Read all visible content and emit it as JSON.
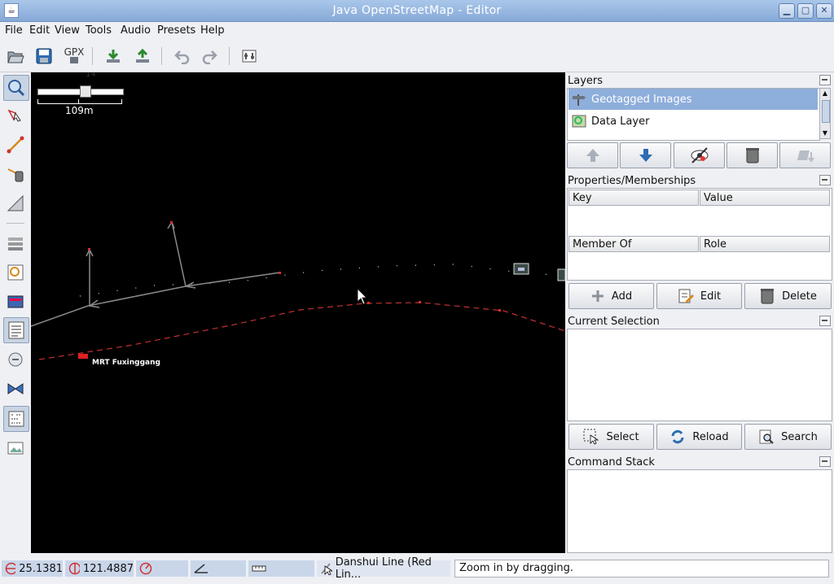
{
  "window": {
    "title": "Java OpenStreetMap - Editor",
    "app_icon": "josm-icon"
  },
  "menu": [
    "File",
    "Edit",
    "View",
    "Tools",
    "Audio",
    "Presets",
    "Help"
  ],
  "toolbar": {
    "gpx_label": "GPX"
  },
  "map": {
    "zoom_label": "14",
    "scale_label": "109m",
    "station_label": "MRT Fuxinggang"
  },
  "layers": {
    "title": "Layers",
    "items": [
      {
        "name": "Geotagged Images",
        "selected": true
      },
      {
        "name": "Data Layer",
        "selected": false
      }
    ]
  },
  "properties": {
    "title": "Properties/Memberships",
    "columns": {
      "key": "Key",
      "value": "Value"
    },
    "member_columns": {
      "member_of": "Member Of",
      "role": "Role"
    },
    "buttons": {
      "add": "Add",
      "edit": "Edit",
      "delete": "Delete"
    }
  },
  "selection": {
    "title": "Current Selection",
    "buttons": {
      "select": "Select",
      "reload": "Reload",
      "search": "Search"
    }
  },
  "command_stack": {
    "title": "Command Stack"
  },
  "status": {
    "lat": "25.1381",
    "lon": "121.4887",
    "name": "Danshui Line (Red Lin...",
    "help": "Zoom in by dragging."
  },
  "colors": {
    "accent": "#8eaedb",
    "titlebar": "#9ab9e2",
    "map_bg": "#000000",
    "rail": "#d23030"
  }
}
